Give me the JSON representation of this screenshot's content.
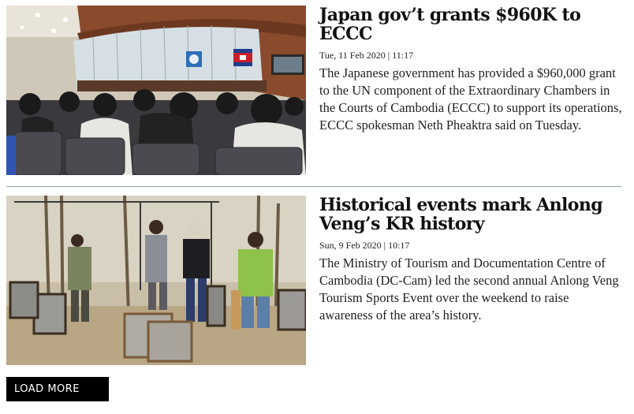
{
  "articles": [
    {
      "headline": "Japan gov’t grants $960K to ECCC",
      "date": "Tue, 11 Feb 2020 | 11:17",
      "summary": "The Japanese government has provided a $960,000 grant to the UN component of the Extraordinary Chambers in the Courts of Cambodia (ECCC) to support its operations, ECCC spokesman Neth Pheaktra said on Tuesday."
    },
    {
      "headline": "Historical events mark Anlong Veng’s KR history",
      "date": "Sun, 9 Feb 2020 | 10:17",
      "summary": "The Ministry of Tourism and Documentation Centre of Cambodia (DC-Cam) led the second annual Anlong Veng Tourism Sports Event over the weekend to raise awareness of the area’s history."
    }
  ],
  "load_more_label": "LOAD MORE",
  "colors": {
    "divider": "#8aa0b4",
    "button_bg": "#000000",
    "button_text": "#ffffff"
  }
}
